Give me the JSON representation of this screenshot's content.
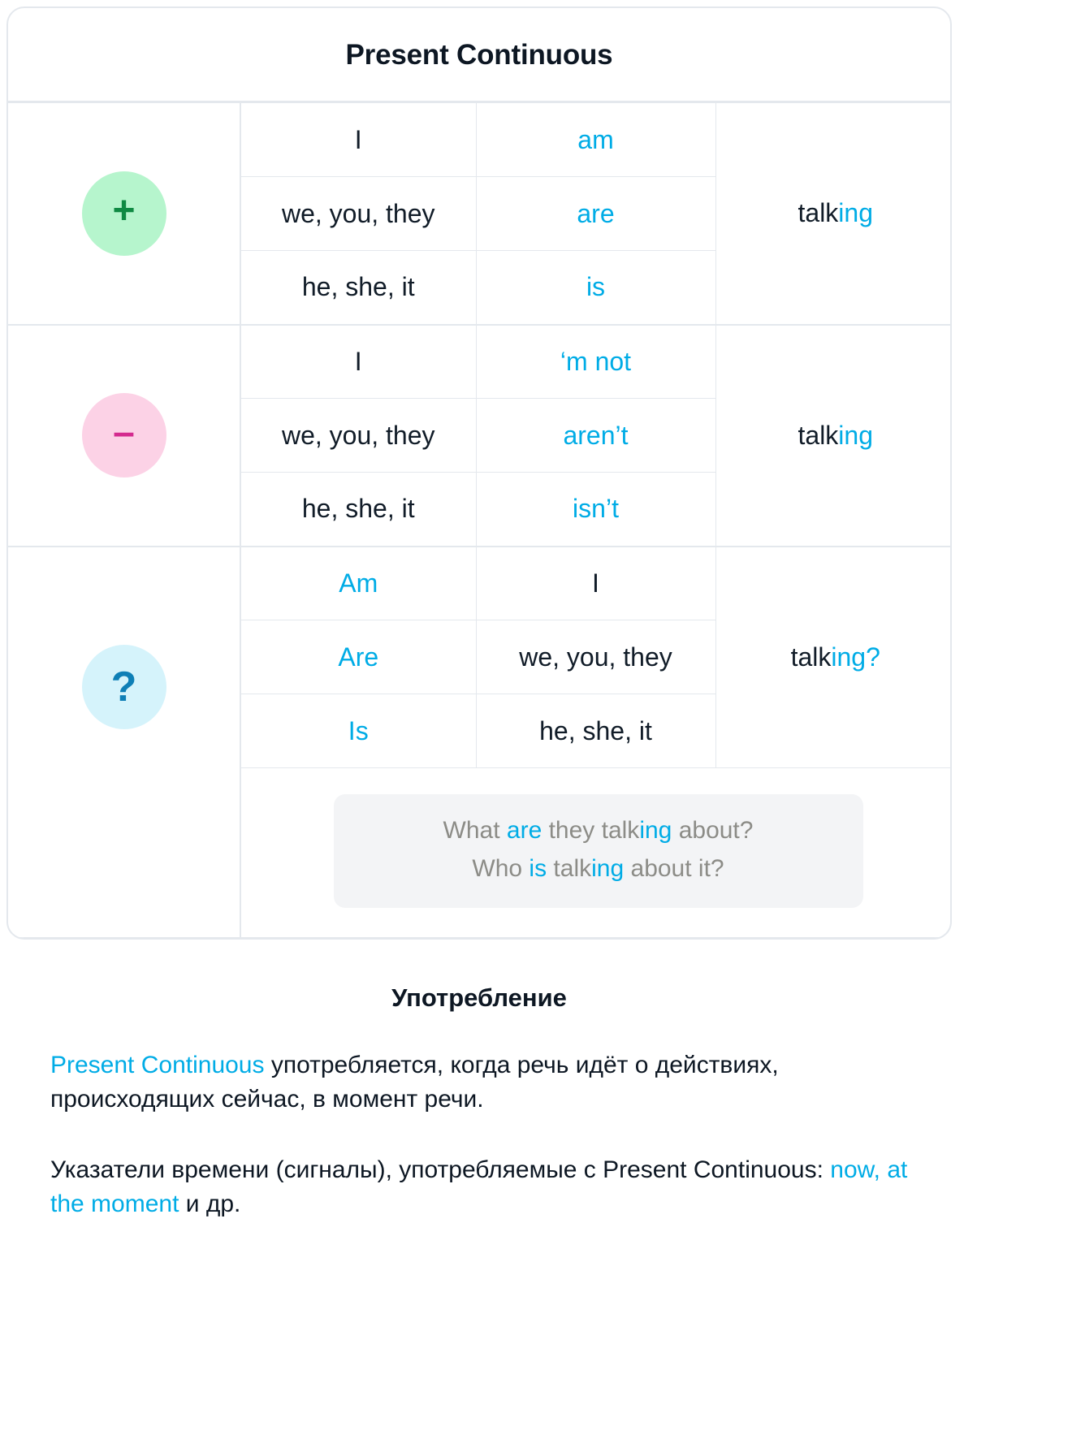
{
  "card": {
    "title": "Present Continuous",
    "sections": [
      {
        "key": "affirmative",
        "badge": {
          "name": "plus-badge",
          "glyph": "+",
          "bg": "#b6f5cd",
          "fg": "#0f8a43"
        },
        "rows": [
          {
            "subject": "I",
            "aux": "am"
          },
          {
            "subject": "we, you, they",
            "aux": "are"
          },
          {
            "subject": "he, she, it",
            "aux": "is"
          }
        ],
        "verb_stem": "talk",
        "verb_suffix": "ing",
        "verb_tail": ""
      },
      {
        "key": "negative",
        "badge": {
          "name": "minus-badge",
          "glyph": "–",
          "bg": "#fcd2e6",
          "fg": "#d42b8f"
        },
        "rows": [
          {
            "subject": "I",
            "aux": "‘m not"
          },
          {
            "subject": "we, you, they",
            "aux": "aren’t"
          },
          {
            "subject": "he, she, it",
            "aux": "isn’t"
          }
        ],
        "verb_stem": "talk",
        "verb_suffix": "ing",
        "verb_tail": ""
      },
      {
        "key": "question",
        "badge": {
          "name": "question-badge",
          "glyph": "?",
          "bg": "#d5f3fb",
          "fg": "#0e7fb6"
        },
        "rows": [
          {
            "aux": "Am",
            "subject": "I"
          },
          {
            "aux": "Are",
            "subject": "we, you, they"
          },
          {
            "aux": "Is",
            "subject": "he, she, it"
          }
        ],
        "verb_stem": "talk",
        "verb_suffix": "ing",
        "verb_tail": "?"
      }
    ],
    "examples": [
      {
        "a": "What ",
        "b": "are",
        "c": " they talk",
        "d": "ing",
        "e": " about?"
      },
      {
        "a": "Who ",
        "b": "is",
        "c": " talk",
        "d": "ing",
        "e": " about it?"
      }
    ]
  },
  "usage": {
    "heading": "Употребление",
    "p1_highlight": "Present Continuous",
    "p1_rest": " употребляется, когда речь идёт о действиях, происходящих сейчас, в момент речи.",
    "p2_before": "Указатели времени (сигналы), употребляемые с Present Continuous: ",
    "p2_highlight": "now, at the moment",
    "p2_after": " и др."
  },
  "colors": {
    "accent_blue": "#00ace6",
    "text_dark": "#0d1723",
    "border": "#e4e8ed",
    "example_gray": "#8c8c87",
    "example_bg": "#f3f4f6"
  }
}
